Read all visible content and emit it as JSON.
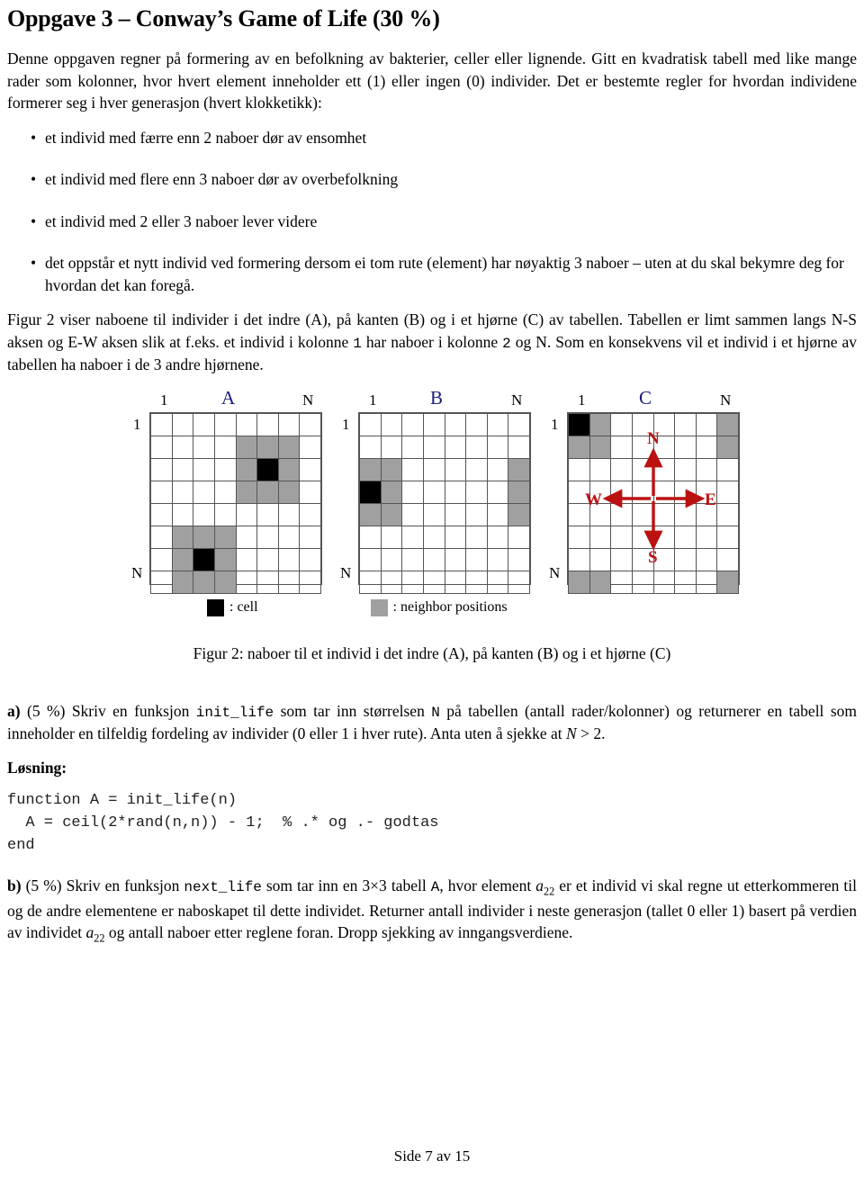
{
  "document": {
    "title": "Oppgave 3 – Conway’s Game of Life (30 %)",
    "intro": "Denne oppgaven regner på formering av en befolkning av bakterier, celler eller lignende. Gitt en kvadratisk tabell med like mange rader som kolonner, hvor hvert element inneholder ett (1) eller ingen (0) individer. Det er bestemte regler for hvordan individene formerer seg i hver generasjon (hvert klokketikk):",
    "rules": [
      "et individ med færre enn 2 naboer dør av ensomhet",
      "et individ med flere enn 3 naboer dør av overbefolkning",
      "et individ med 2 eller 3 naboer lever videre",
      "det oppstår et nytt individ ved formering dersom ei tom rute (element) har nøyaktig 3 naboer – uten at du skal bekymre deg for hvordan det kan foregå."
    ],
    "bullet_glyph": "•",
    "figure_intro": {
      "part1": "Figur 2 viser naboene til individer i det indre (A), på kanten (B) og i et hjørne (C) av tabellen. Tabellen er limt sammen langs N-S aksen og E-W aksen slik at f.eks. et individ i kolonne ",
      "code1": "1",
      "part2": " har naboer i kolonne ",
      "code2": "2",
      "part3": " og N. Som en konsekvens vil et individ i et hjørne av tabellen ha naboer i de 3 andre hjørnene."
    }
  },
  "figure": {
    "size": 8,
    "axis": {
      "first": "1",
      "last": "N"
    },
    "grids": [
      {
        "letter": "A",
        "black": [
          [
            3,
            6
          ],
          [
            7,
            3
          ]
        ],
        "gray": [
          [
            2,
            5
          ],
          [
            2,
            6
          ],
          [
            2,
            7
          ],
          [
            3,
            5
          ],
          [
            3,
            7
          ],
          [
            4,
            5
          ],
          [
            4,
            6
          ],
          [
            4,
            7
          ],
          [
            6,
            2
          ],
          [
            6,
            3
          ],
          [
            6,
            4
          ],
          [
            7,
            2
          ],
          [
            7,
            4
          ],
          [
            8,
            2
          ],
          [
            8,
            3
          ],
          [
            8,
            4
          ]
        ]
      },
      {
        "letter": "B",
        "black": [
          [
            4,
            1
          ]
        ],
        "gray": [
          [
            3,
            1
          ],
          [
            3,
            2
          ],
          [
            4,
            2
          ],
          [
            5,
            1
          ],
          [
            5,
            2
          ],
          [
            3,
            8
          ],
          [
            4,
            8
          ],
          [
            5,
            8
          ]
        ]
      },
      {
        "letter": "C",
        "black": [
          [
            1,
            1
          ]
        ],
        "gray": [
          [
            1,
            2
          ],
          [
            2,
            1
          ],
          [
            2,
            2
          ],
          [
            1,
            8
          ],
          [
            2,
            8
          ],
          [
            8,
            1
          ],
          [
            8,
            2
          ],
          [
            8,
            8
          ]
        ],
        "compass": {
          "n": "N",
          "e": "E",
          "s": "S",
          "w": "W",
          "color": "#bb1111"
        }
      }
    ],
    "legend": [
      {
        "swatch": "black",
        "label": ": cell"
      },
      {
        "swatch": "gray",
        "label": ": neighbor positions"
      }
    ],
    "caption": "Figur 2: naboer til et individ i det indre (A), på kanten (B) og i et hjørne (C)",
    "letter_color": "#1a1a7a",
    "cell_black": "#000000",
    "cell_gray": "#a0a0a0",
    "grid_line": "#555555"
  },
  "task_a": {
    "label": "a)",
    "percent": "(5 %)",
    "text_1": " Skriv en funksjon ",
    "code_fn": "init_life",
    "text_2": " som tar inn størrelsen ",
    "code_n": "N",
    "text_3": " på tabellen (antall rader/kolonner) og returnerer en tabell som inneholder en tilfeldig fordeling av individer (0 eller 1 i hver rute). Anta uten å sjekke at ",
    "math_n": "N",
    "math_rest": " > 2.",
    "losning_label": "Løsning:",
    "code": "function A = init_life(n)\n  A = ceil(2*rand(n,n)) - 1;  % .* og .- godtas\nend"
  },
  "task_b": {
    "label": "b)",
    "percent": "(5 %)",
    "text_1": " Skriv en funksjon ",
    "code_fn": "next_life",
    "text_2": " som tar inn en 3×3 tabell ",
    "code_a": "A",
    "text_3": ", hvor element ",
    "math_a22_base": "a",
    "math_a22_sub": "22",
    "text_4": " er et individ vi skal regne ut etterkommeren til og de andre elementene er naboskapet til dette individet. Returner antall individer i neste generasjon (tallet 0 eller 1) basert på verdien av individet ",
    "text_5": " og antall naboer etter reglene foran. Dropp sjekking av inngangsverdiene."
  },
  "footer": {
    "page_text": "Side 7 av 15"
  }
}
